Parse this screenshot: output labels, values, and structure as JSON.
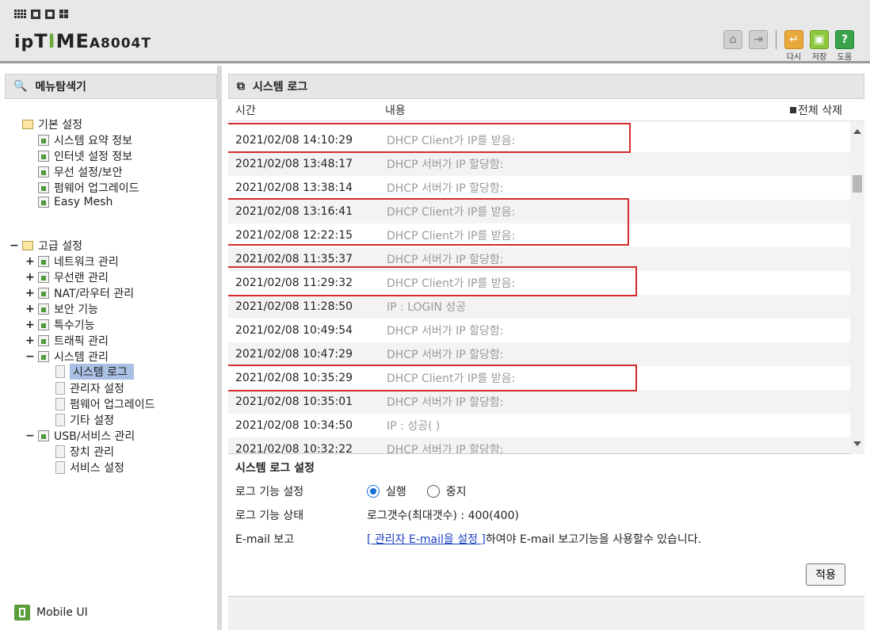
{
  "header": {
    "brand_ip": "ip",
    "brand_time_t": "T",
    "brand_time_i": "I",
    "brand_time_me": "ME",
    "brand_model": "A8004T",
    "buttons": [
      {
        "label": "다시",
        "icon": "undo-icon"
      },
      {
        "label": "저장",
        "icon": "save-icon"
      },
      {
        "label": "도움",
        "icon": "help-icon"
      }
    ]
  },
  "sidebar": {
    "title": "메뉴탐색기",
    "basic": {
      "label": "기본 설정",
      "items": [
        "시스템 요약 정보",
        "인터넷 설정 정보",
        "무선 설정/보안",
        "펌웨어 업그레이드",
        "Easy Mesh"
      ]
    },
    "advanced": {
      "label": "고급 설정",
      "items": [
        "네트워크 관리",
        "무선랜 관리",
        "NAT/라우터 관리",
        "보안 기능",
        "특수기능",
        "트래픽 관리",
        "시스템 관리"
      ],
      "system_sub": [
        "시스템 로그",
        "관리자 설정",
        "펌웨어 업그레이드",
        "기타 설정"
      ],
      "usb": "USB/서비스 관리",
      "usb_sub": [
        "장치 관리",
        "서비스 설정"
      ]
    },
    "mobile": "Mobile UI"
  },
  "main": {
    "title": "시스템 로그",
    "col_time": "시간",
    "col_content": "내용",
    "clear_all": "전체 삭제",
    "logs": [
      {
        "time": "2021/02/08 14:10:29",
        "msg": "DHCP Client가 IP를 받음:"
      },
      {
        "time": "2021/02/08 13:48:17",
        "msg": "DHCP 서버가 IP 할당함:"
      },
      {
        "time": "2021/02/08 13:38:14",
        "msg": "DHCP 서버가 IP 할당함:"
      },
      {
        "time": "2021/02/08 13:16:41",
        "msg": "DHCP Client가 IP를 받음:"
      },
      {
        "time": "2021/02/08 12:22:15",
        "msg": "DHCP Client가 IP를 받음:"
      },
      {
        "time": "2021/02/08 11:35:37",
        "msg": "DHCP 서버가 IP 할당함:"
      },
      {
        "time": "2021/02/08 11:29:32",
        "msg": "DHCP Client가 IP를 받음:"
      },
      {
        "time": "2021/02/08 11:28:50",
        "msg": "IP :                     LOGIN 성공"
      },
      {
        "time": "2021/02/08 10:49:54",
        "msg": "DHCP 서버가 IP 할당함:"
      },
      {
        "time": "2021/02/08 10:47:29",
        "msg": "DHCP 서버가 IP 할당함:"
      },
      {
        "time": "2021/02/08 10:35:29",
        "msg": "DHCP Client가 IP를 받음:"
      },
      {
        "time": "2021/02/08 10:35:01",
        "msg": "DHCP 서버가 IP 할당함:"
      },
      {
        "time": "2021/02/08 10:34:50",
        "msg": "IP :                          성공(                                 )"
      },
      {
        "time": "2021/02/08 10:32:22",
        "msg": "DHCP 서버가 IP 할당함:"
      }
    ],
    "settings": {
      "title": "시스템 로그 설정",
      "log_func_label": "로그 기능 설정",
      "opt_run": "실행",
      "opt_stop": "중지",
      "log_status_label": "로그 기능 상태",
      "log_status_value": "로그갯수(최대갯수) : 400(400)",
      "email_label": "E-mail 보고",
      "email_link": "[ 관리자 E-mail을 설정 ]",
      "email_text": "하여야 E-mail 보고기능을 사용할수 있습니다.",
      "apply": "적용"
    }
  }
}
